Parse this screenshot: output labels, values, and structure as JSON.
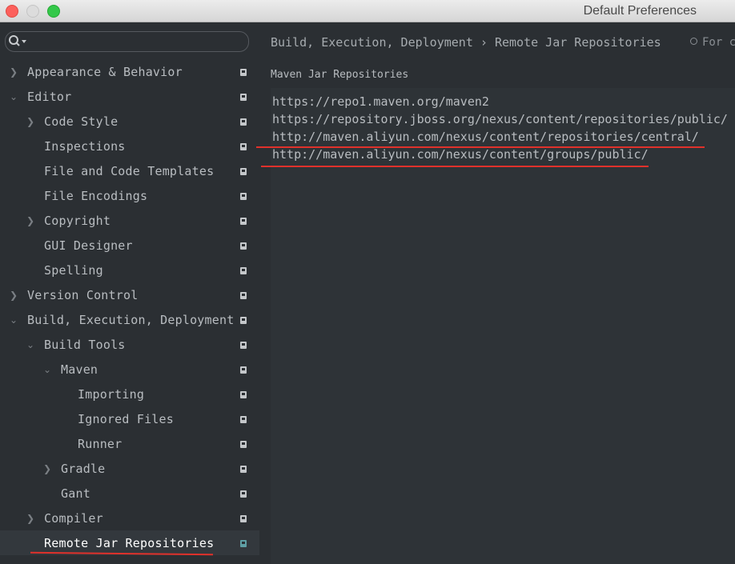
{
  "window": {
    "title": "Default Preferences"
  },
  "search": {
    "placeholder": ""
  },
  "sidebar": {
    "items": [
      {
        "label": "Appearance & Behavior",
        "arrow": "right"
      },
      {
        "label": "Editor",
        "arrow": "down"
      },
      {
        "label": "Code Style",
        "arrow": "right"
      },
      {
        "label": "Inspections",
        "arrow": ""
      },
      {
        "label": "File and Code Templates",
        "arrow": ""
      },
      {
        "label": "File Encodings",
        "arrow": ""
      },
      {
        "label": "Copyright",
        "arrow": "right"
      },
      {
        "label": "GUI Designer",
        "arrow": ""
      },
      {
        "label": "Spelling",
        "arrow": ""
      },
      {
        "label": "Version Control",
        "arrow": "right"
      },
      {
        "label": "Build, Execution, Deployment",
        "arrow": "down"
      },
      {
        "label": "Build Tools",
        "arrow": "down"
      },
      {
        "label": "Maven",
        "arrow": "down"
      },
      {
        "label": "Importing",
        "arrow": ""
      },
      {
        "label": "Ignored Files",
        "arrow": ""
      },
      {
        "label": "Runner",
        "arrow": ""
      },
      {
        "label": "Gradle",
        "arrow": "right"
      },
      {
        "label": "Gant",
        "arrow": ""
      },
      {
        "label": "Compiler",
        "arrow": "right"
      },
      {
        "label": "Remote Jar Repositories",
        "arrow": "",
        "selected": true
      }
    ]
  },
  "content": {
    "breadcrumb": "Build, Execution, Deployment › Remote Jar Repositories",
    "for_link": "For c",
    "section_title": "Maven Jar Repositories",
    "repositories": [
      "https://repo1.maven.org/maven2",
      "https://repository.jboss.org/nexus/content/repositories/public/",
      "http://maven.aliyun.com/nexus/content/repositories/central/",
      "http://maven.aliyun.com/nexus/content/groups/public/"
    ]
  },
  "colors": {
    "background": "#2b2f33",
    "text": "#b9bdc1",
    "annotation": "#e0312b"
  }
}
